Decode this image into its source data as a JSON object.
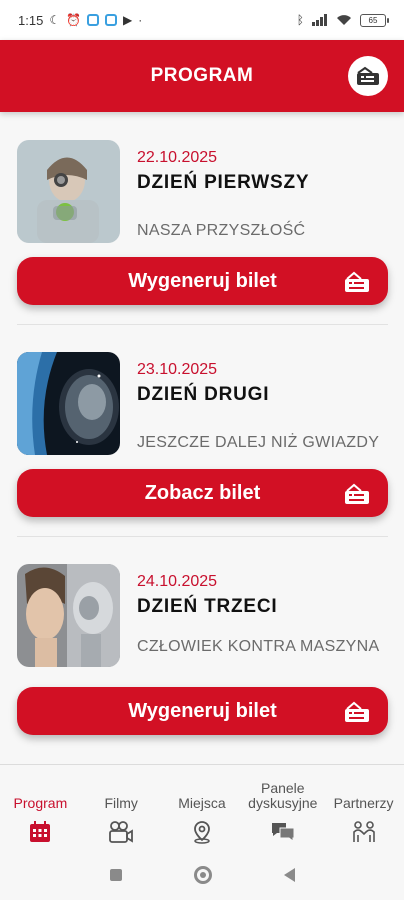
{
  "status_bar": {
    "time": "1:15",
    "battery": "65"
  },
  "header": {
    "title": "PROGRAM",
    "icon": "ticket-icon"
  },
  "days": [
    {
      "date": "22.10.2025",
      "title": "DZIEŃ PIERWSZY",
      "subtitle": "NASZA PRZYSZŁOŚĆ",
      "button_label": "Wygeneruj bilet",
      "image": "woman-robot-apple-image"
    },
    {
      "date": "23.10.2025",
      "title": "DZIEŃ DRUGI",
      "subtitle": "JESZCZE DALEJ NIŻ GWIAZDY",
      "button_label": "Zobacz bilet",
      "image": "astronaut-space-image"
    },
    {
      "date": "24.10.2025",
      "title": "DZIEŃ TRZECI",
      "subtitle": "CZŁOWIEK KONTRA MASZYNA",
      "button_label": "Wygeneruj bilet",
      "image": "woman-and-robot-image"
    }
  ],
  "nav": {
    "items": [
      {
        "label": "Program",
        "icon": "calendar-icon",
        "active": true
      },
      {
        "label": "Filmy",
        "icon": "video-camera-icon",
        "active": false
      },
      {
        "label": "Miejsca",
        "icon": "location-pin-icon",
        "active": false
      },
      {
        "label": "Panele dyskusyjne",
        "icon": "chat-bubbles-icon",
        "active": false
      },
      {
        "label": "Partnerzy",
        "icon": "partners-icon",
        "active": false
      }
    ]
  },
  "colors": {
    "brand_red": "#d21024",
    "accent_text_red": "#c8102e"
  }
}
